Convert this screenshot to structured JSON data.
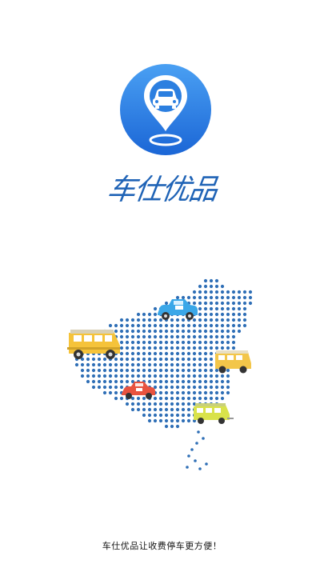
{
  "brand": {
    "name": "车仕优品",
    "colors": {
      "primary": "#1f63b6",
      "gradient_top": "#4aa0f3",
      "gradient_bottom": "#1b66d6"
    },
    "logo_icon": "car-location-pin-icon"
  },
  "illustration": {
    "map_icon": "china-dotted-map-icon",
    "dot_color": "#2f6fb6",
    "cars": [
      {
        "name": "blue-car-icon",
        "color": "#3aa7e8"
      },
      {
        "name": "yellow-van-icon",
        "color": "#f5c33a"
      },
      {
        "name": "yellow-beige-van-icon",
        "color": "#f3c64a"
      },
      {
        "name": "red-car-icon",
        "color": "#e8533f"
      },
      {
        "name": "yellow-green-van-icon",
        "color": "#d9e24a"
      }
    ]
  },
  "slogan": "车仕优品让收费停车更方便！"
}
